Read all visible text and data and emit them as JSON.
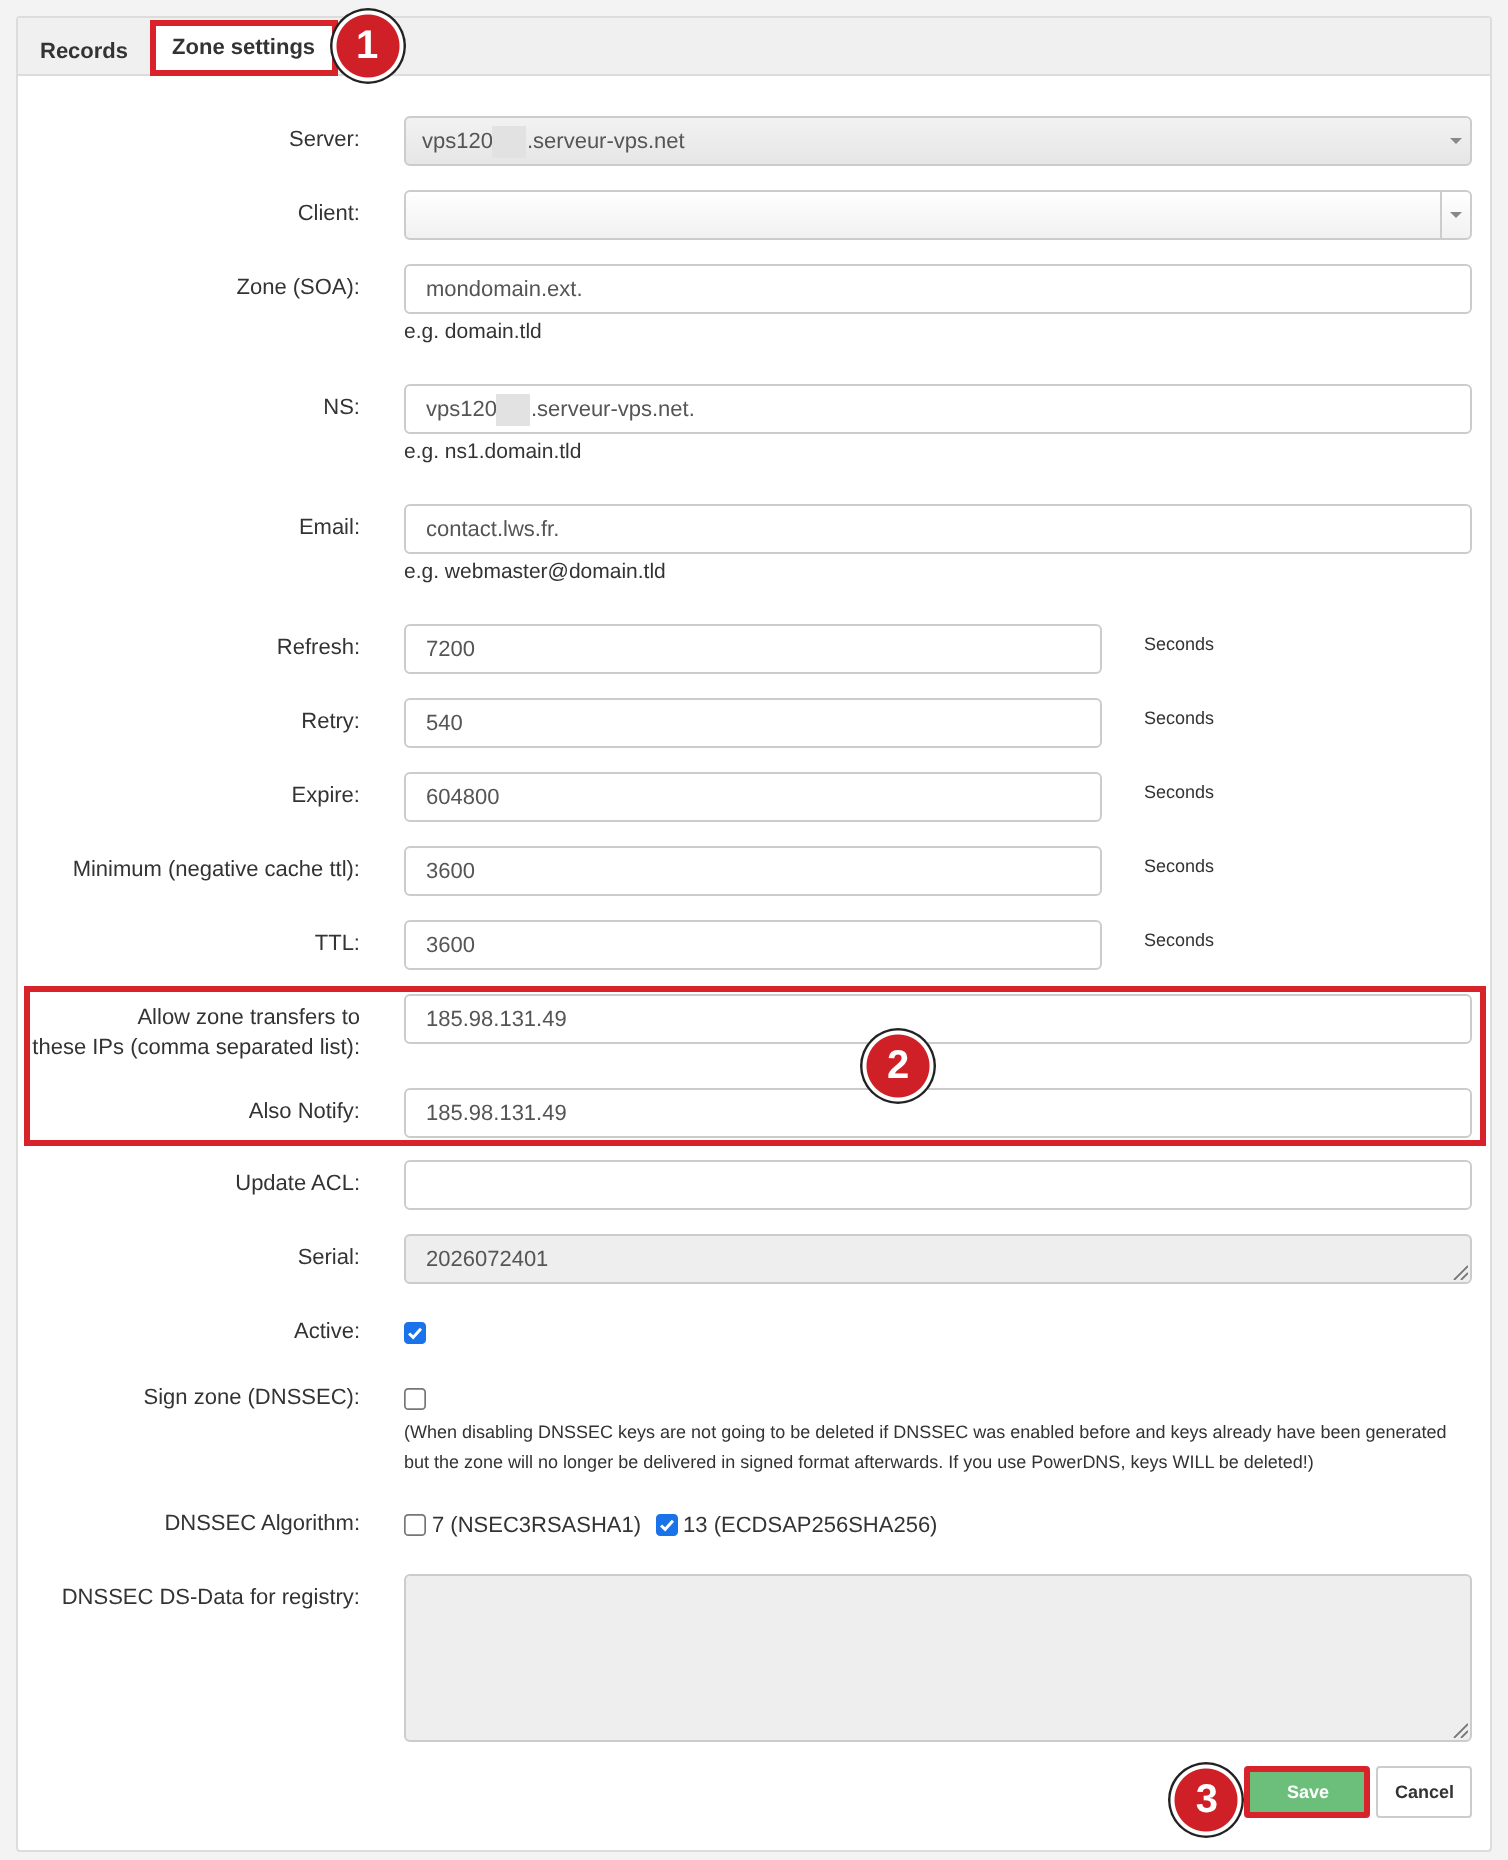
{
  "tabs": [
    {
      "label": "Records",
      "selected": false,
      "highlight": false
    },
    {
      "label": "Zone settings",
      "selected": true,
      "highlight": true,
      "marker": "1"
    }
  ],
  "fields": [
    {
      "kind": "select",
      "label": "Server:",
      "value_parts": [
        "vps120",
        ".serveur-vps.net"
      ],
      "disabled": true
    },
    {
      "kind": "select",
      "label": "Client:",
      "disabled": false
    },
    {
      "kind": "text",
      "label": "Zone (SOA):",
      "value_parts": [
        "mondomain.ext."
      ],
      "hint": "e.g. domain.tld",
      "disabled": false
    },
    {
      "kind": "text",
      "label": "NS:",
      "value_parts": [
        "vps120",
        ".serveur-vps.net."
      ],
      "hint": "e.g. ns1.domain.tld",
      "disabled": false
    },
    {
      "kind": "text",
      "label": "Email:",
      "value_parts": [
        "contact.lws.fr."
      ],
      "hint": "e.g. webmaster@domain.tld",
      "disabled": false
    },
    {
      "kind": "number",
      "label": "Refresh:",
      "value_parts": [
        "7200"
      ],
      "unit": "Seconds",
      "disabled": false
    },
    {
      "kind": "number",
      "label": "Retry:",
      "value_parts": [
        "540"
      ],
      "unit": "Seconds",
      "disabled": false
    },
    {
      "kind": "number",
      "label": "Expire:",
      "value_parts": [
        "604800"
      ],
      "unit": "Seconds",
      "disabled": false
    },
    {
      "kind": "number",
      "label": "Minimum (negative cache ttl):",
      "value_parts": [
        "3600"
      ],
      "unit": "Seconds",
      "disabled": false
    },
    {
      "kind": "number",
      "label": "TTL:",
      "value_parts": [
        "3600"
      ],
      "unit": "Seconds",
      "disabled": false
    },
    {
      "kind": "group",
      "highlight": true,
      "marker": "2",
      "fields": [
        {
          "kind": "text",
          "label": "Allow zone transfers to\nthese IPs (comma separated list):",
          "value_parts": [
            "185.98.131.49"
          ],
          "disabled": false
        },
        {
          "kind": "text",
          "label": "Also Notify:",
          "value_parts": [
            "185.98.131.49"
          ],
          "disabled": false
        }
      ]
    },
    {
      "kind": "text",
      "label": "Update ACL:",
      "disabled": false
    },
    {
      "kind": "textarea",
      "label": "Serial:",
      "value_parts": [
        "2026072401"
      ],
      "disabled": true
    },
    {
      "kind": "checkbox",
      "label": "Active:",
      "checked": true,
      "disabled": false
    },
    {
      "kind": "checkbox",
      "label": "Sign zone (DNSSEC):",
      "checked": false,
      "note": "(When disabling DNSSEC keys are not going to be deleted if DNSSEC was enabled before and keys already have been generated but the zone will no longer be delivered in signed format afterwards. If you use PowerDNS, keys WILL be deleted!)",
      "disabled": false
    },
    {
      "kind": "checkbox_group",
      "label": "DNSSEC Algorithm:",
      "options": [
        {
          "label": "7 (NSEC3RSASHA1)",
          "checked": false
        },
        {
          "label": "13 (ECDSAP256SHA256)",
          "checked": true
        }
      ],
      "disabled": false
    },
    {
      "kind": "large_textarea",
      "label": "DNSSEC DS-Data for registry:",
      "disabled": true
    }
  ],
  "buttons": [
    {
      "label": "Save",
      "kind": "primary",
      "highlight": true,
      "marker": "3"
    },
    {
      "label": "Cancel",
      "kind": "default",
      "highlight": false
    }
  ]
}
